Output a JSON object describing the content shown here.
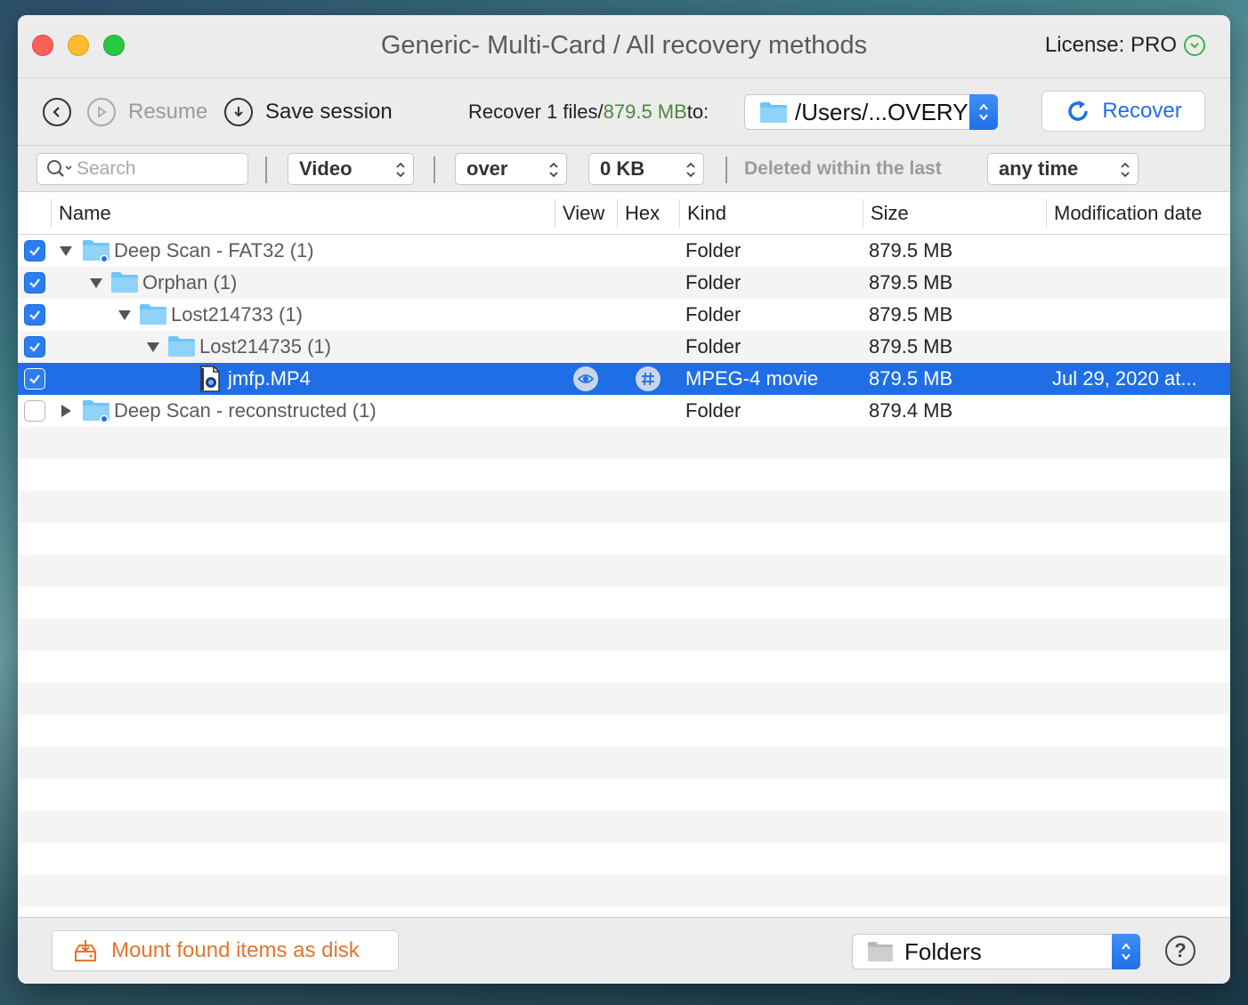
{
  "window": {
    "title": "Generic- Multi-Card / All recovery methods",
    "license": "License: PRO"
  },
  "toolbar": {
    "resume_label": "Resume",
    "save_session_label": "Save session",
    "recover_prefix": "Recover 1 files/",
    "recover_size": "879.5 MB",
    "recover_suffix": " to:",
    "destination_path": "/Users/...OVERY",
    "recover_button_label": "Recover"
  },
  "filters": {
    "search_placeholder": "Search",
    "type_value": "Video",
    "comparison_value": "over",
    "size_value": "0 KB",
    "deleted_label": "Deleted within the last",
    "time_value": "any time"
  },
  "table": {
    "columns": [
      "Name",
      "View",
      "Hex",
      "Kind",
      "Size",
      "Modification date"
    ],
    "rows": [
      {
        "name": "Deep Scan - FAT32 (1)",
        "kind": "Folder",
        "size": "879.5 MB",
        "date": ""
      },
      {
        "name": "Orphan (1)",
        "kind": "Folder",
        "size": "879.5 MB",
        "date": ""
      },
      {
        "name": "Lost214733 (1)",
        "kind": "Folder",
        "size": "879.5 MB",
        "date": ""
      },
      {
        "name": "Lost214735 (1)",
        "kind": "Folder",
        "size": "879.5 MB",
        "date": ""
      },
      {
        "name": "jmfp.MP4",
        "kind": "MPEG-4 movie",
        "size": "879.5 MB",
        "date": "Jul 29, 2020 at..."
      },
      {
        "name": "Deep Scan - reconstructed (1)",
        "kind": "Folder",
        "size": "879.4 MB",
        "date": ""
      }
    ]
  },
  "bottom": {
    "mount_label": "Mount found items as disk",
    "view_mode": "Folders",
    "help_label": "?"
  },
  "colors": {
    "accent": "#1f6ee6",
    "green": "#4b8a3a",
    "orange": "#e8732c"
  }
}
